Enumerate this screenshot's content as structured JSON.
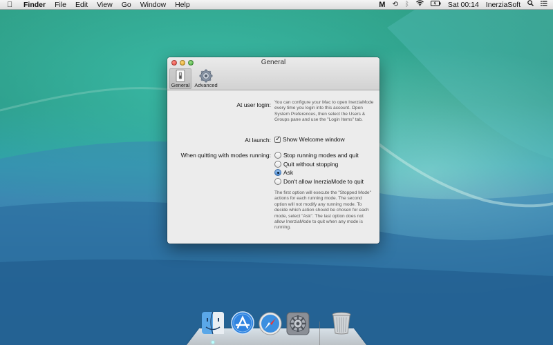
{
  "menubar": {
    "app_name": "Finder",
    "menus": [
      "File",
      "Edit",
      "View",
      "Go",
      "Window",
      "Help"
    ],
    "status_items": [
      "M",
      "time-machine-icon",
      "bluetooth-icon",
      "wifi-icon",
      "battery-icon"
    ],
    "clock": "Sat 00:14",
    "user": "InerziaSoft"
  },
  "window": {
    "title": "General",
    "toolbar": [
      {
        "label": "General",
        "icon": "switch-icon",
        "selected": true
      },
      {
        "label": "Advanced",
        "icon": "gear-icon",
        "selected": false
      }
    ]
  },
  "general": {
    "login_label": "At user login:",
    "login_help": "You can configure your Mac to open InerziaMode every time you login into this account. Open System Preferences, then select the Users & Groups pane and use the \"Login Items\" tab.",
    "launch_label": "At launch:",
    "show_welcome_label": "Show Welcome window",
    "show_welcome_checked": true,
    "quitting_label": "When quitting with modes running:",
    "quit_options": [
      {
        "label": "Stop running modes and quit",
        "selected": false
      },
      {
        "label": "Quit without stopping",
        "selected": false
      },
      {
        "label": "Ask",
        "selected": true
      },
      {
        "label": "Don't allow InerziaMode to quit",
        "selected": false
      }
    ],
    "quit_help": "The first option will execute the \"Stopped Mode\" actions for each running mode. The second option will not modify any running mode. To decide which action should be chosen for each mode, select \"Ask\". The last option does not allow InerziaMode to quit when any mode is running."
  },
  "dock": {
    "items": [
      "finder-icon",
      "app-store-icon",
      "safari-icon",
      "system-preferences-icon",
      "trash-icon"
    ]
  }
}
